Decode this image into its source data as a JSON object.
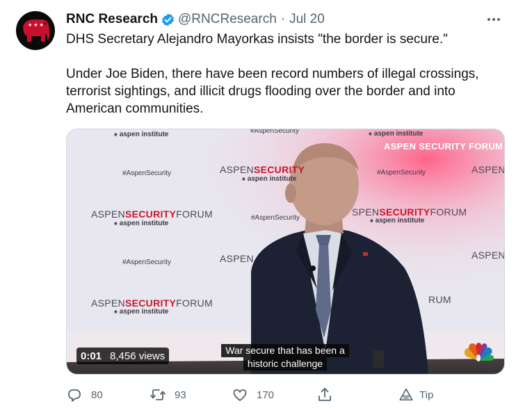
{
  "author": {
    "display_name": "RNC Research",
    "handle": "@RNCResearch",
    "separator": "·",
    "date": "Jul 20",
    "brand_color": "#c8102e",
    "verified_color": "#1d9bf0"
  },
  "tweet": {
    "paragraphs": [
      "DHS Secretary Alejandro Mayorkas insists \"the border is secure.\"",
      "Under Joe Biden, there have been record numbers of illegal crossings, terrorist sightings, and illicit drugs flooding over the border and into American communities."
    ]
  },
  "media": {
    "banner": "ASPEN SECURITY FORUM",
    "backdrop": {
      "aspen_word": "ASPEN",
      "security_word": "SECURITY",
      "forum_word": "FORUM",
      "institute": "aspen institute",
      "hashtag": "#AspenSecurity",
      "partial_aspen": "ASPEN",
      "partial_aspen_s": "ASPENS",
      "partial_rum": "RUM",
      "partial_top": "#AspenSecurity",
      "partial_forum_tail": "SPEN",
      "partial_hash_right": "#"
    },
    "caption_lines": [
      "War secure that has been a",
      "historic challenge"
    ],
    "timestamp": "0:01",
    "views": "8,456 views"
  },
  "actions": {
    "reply_count": "80",
    "retweet_count": "93",
    "like_count": "170",
    "tip_label": "Tip"
  },
  "icons": {
    "verified": "verified-badge-icon",
    "more": "more-icon",
    "reply": "reply-icon",
    "retweet": "retweet-icon",
    "like": "like-icon",
    "share": "share-icon",
    "tip": "tip-icon"
  }
}
